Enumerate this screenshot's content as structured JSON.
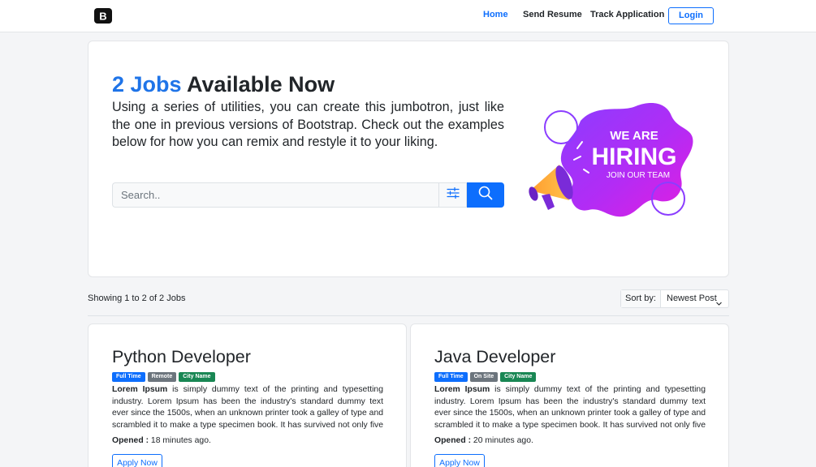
{
  "navbar": {
    "brand_icon": "bootstrap-logo-icon",
    "links": [
      "Home",
      "Send Resume",
      "Track Application"
    ],
    "login_label": "Login"
  },
  "hero": {
    "title_count": "2 Jobs",
    "title_rest": "Available Now",
    "text": "Using a series of utilities, you can create this jumbotron, just like the one in previous versions of Bootstrap. Check out the examples below for how you can remix and restyle it to your liking.",
    "search_placeholder": "Search..",
    "filter_icon": "sliders-icon",
    "search_icon": "search-icon",
    "art": {
      "line1": "WE ARE",
      "line2": "HIRING",
      "line3": "JOIN OUR TEAM"
    }
  },
  "results": {
    "summary": "Showing 1 to 2 of 2 Jobs",
    "sort_label": "Sort by:",
    "sort_value": "Newest Post"
  },
  "jobs": [
    {
      "title": "Python Developer",
      "badges": [
        "Full Time",
        "Remote",
        "City Name"
      ],
      "desc_lead": "Lorem Ipsum",
      "desc_rest": " is simply dummy text of the printing and typesetting industry. Lorem Ipsum has been the industry's standard dummy text ever since the 1500s, when an unknown printer took a galley of type and scrambled it to make a type specimen book. It has survived not only five centuries, but al...",
      "opened_label": "Opened :",
      "opened_value": " 18 minutes ago.",
      "apply_label": "Apply Now"
    },
    {
      "title": "Java Developer",
      "badges": [
        "Full Time",
        "On Site",
        "City Name"
      ],
      "desc_lead": "Lorem Ipsum",
      "desc_rest": " is simply dummy text of the printing and typesetting industry. Lorem Ipsum has been the industry's standard dummy text ever since the 1500s, when an unknown printer took a galley of type and scrambled it to make a type specimen book. It has survived not only five centuries, but al...",
      "opened_label": "Opened :",
      "opened_value": " 20 minutes ago.",
      "apply_label": "Apply Now"
    }
  ],
  "colors": {
    "accent": "#0d6efd",
    "count": "#1f74e8",
    "badge_secondary": "#6c757d",
    "badge_success": "#198754"
  }
}
